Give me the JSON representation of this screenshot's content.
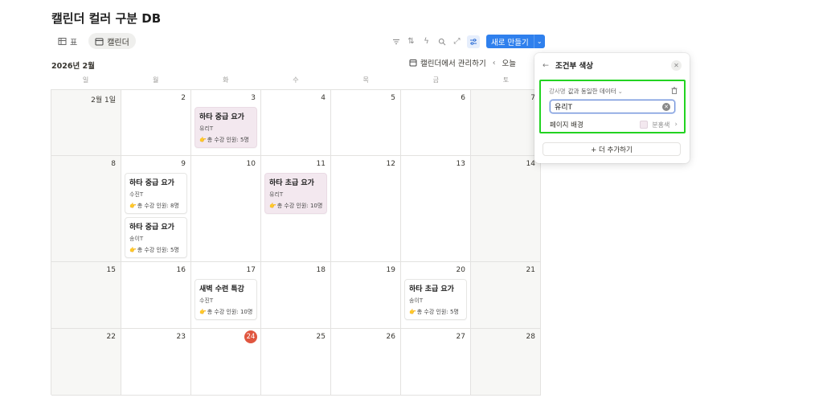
{
  "page": {
    "title": "캘린더 컬러 구분 DB"
  },
  "views": [
    {
      "label": "표",
      "icon": "table-icon"
    },
    {
      "label": "캘린더",
      "icon": "calendar-icon",
      "active": true
    }
  ],
  "toolbar": {
    "new_label": "새로 만들기"
  },
  "calendar": {
    "month_label": "2026년 2월",
    "manage_label": "캘린더에서 관리하기",
    "today_label": "오늘",
    "weekdays": [
      "일",
      "월",
      "화",
      "수",
      "목",
      "금",
      "토"
    ],
    "days": {
      "d1": "2월 1일",
      "d2": "2",
      "d3": "3",
      "d4": "4",
      "d5": "5",
      "d6": "6",
      "d7": "7",
      "d8": "8",
      "d9": "9",
      "d10": "10",
      "d11": "11",
      "d12": "12",
      "d13": "13",
      "d14": "14",
      "d15": "15",
      "d16": "16",
      "d17": "17",
      "d18": "18",
      "d19": "19",
      "d20": "20",
      "d21": "21",
      "d22": "22",
      "d23": "23",
      "d24": "24",
      "d25": "25",
      "d26": "26",
      "d27": "27",
      "d28": "28"
    },
    "events": [
      {
        "title": "하타 중급 요가",
        "teacher": "유리T",
        "count": "총 수강 인원: 5명"
      },
      {
        "title": "하타 중급 요가",
        "teacher": "수진T",
        "count": "총 수강 인원: 8명"
      },
      {
        "title": "하타 중급 요가",
        "teacher": "송이T",
        "count": "총 수강 인원: 5명"
      },
      {
        "title": "하타 초급 요가",
        "teacher": "유리T",
        "count": "총 수강 인원: 10명"
      },
      {
        "title": "새벽 수련 특강",
        "teacher": "수진T",
        "count": "총 수강 인원: 10명"
      },
      {
        "title": "하타 초급 요가",
        "teacher": "송이T",
        "count": "총 수강 인원: 5명"
      }
    ]
  },
  "popup": {
    "title": "조건부 색상",
    "filter_prop": "강사명",
    "filter_op": "값과 동일한 데이터",
    "filter_value": "유리T",
    "bg_label": "페이지 배경",
    "bg_color_name": "분홍색",
    "add_more": "+ 더 추가하기",
    "accent_color": "#22d321"
  }
}
